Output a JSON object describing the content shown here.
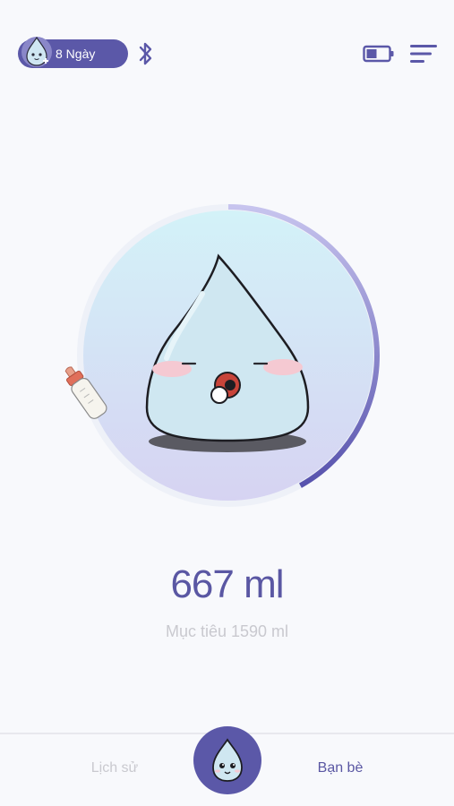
{
  "header": {
    "streak_label": "8 Ngày",
    "icons": [
      "mascot-avatar-icon",
      "bluetooth-icon",
      "battery-icon",
      "menu-icon"
    ]
  },
  "progress": {
    "intake_ml": 667,
    "goal_ml": 1590,
    "amount_text": "667 ml",
    "goal_text": "Mục tiêu 1590 ml"
  },
  "bottom_nav": {
    "history_label": "Lịch sử",
    "friends_label": "Bạn bè",
    "center_icon": "mascot-drop-icon"
  },
  "colors": {
    "accent": "#5b58a8",
    "ring_progress": "#5f5cb0",
    "muted_text": "#c9c9cf",
    "background": "#f8f9fc"
  }
}
